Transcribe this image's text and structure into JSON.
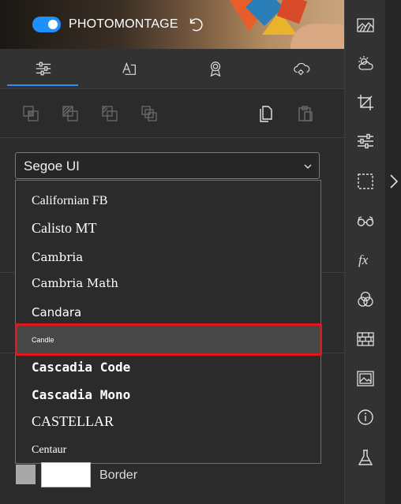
{
  "header": {
    "title": "PHOTOMONTAGE",
    "toggle_on": true
  },
  "tabs": [
    {
      "id": "adjust",
      "icon": "sliders-icon",
      "active": true
    },
    {
      "id": "text",
      "icon": "text-box-icon",
      "active": false
    },
    {
      "id": "badge",
      "icon": "award-icon",
      "active": false
    },
    {
      "id": "cloud",
      "icon": "cloud-settings-icon",
      "active": false
    }
  ],
  "toolbar": [
    "layer-back-icon",
    "layer-backward-icon",
    "layer-forward-icon",
    "layer-front-icon",
    "copy-icon",
    "paste-icon"
  ],
  "font_select": {
    "value": "Segoe UI"
  },
  "font_options": [
    {
      "label": "Californian FB",
      "family": "Liberation Serif",
      "size": "16px",
      "weight": "normal"
    },
    {
      "label": "Calisto MT",
      "family": "Liberation Serif",
      "size": "18px",
      "weight": "normal"
    },
    {
      "label": "Cambria",
      "family": "DejaVu Serif",
      "size": "15px",
      "weight": "normal"
    },
    {
      "label": "Cambria Math",
      "family": "DejaVu Serif",
      "size": "15px",
      "weight": "normal"
    },
    {
      "label": "Candara",
      "family": "DejaVu Sans",
      "size": "15px",
      "weight": "normal"
    },
    {
      "label": "Candle",
      "family": "Liberation Sans",
      "size": "9px",
      "weight": "normal",
      "selected": true
    },
    {
      "label": "Cascadia Code",
      "family": "DejaVu Sans Mono",
      "size": "16px",
      "weight": "bold"
    },
    {
      "label": "Cascadia Mono",
      "family": "DejaVu Sans Mono",
      "size": "16px",
      "weight": "bold"
    },
    {
      "label": "CASTELLAR",
      "family": "Liberation Serif",
      "size": "18px",
      "weight": "normal"
    },
    {
      "label": "Centaur",
      "family": "Liberation Serif",
      "size": "14px",
      "weight": "normal"
    }
  ],
  "border": {
    "label": "Border",
    "swatch_color": "#a8a8a8",
    "fill_color": "#ffffff"
  },
  "sidebar_icons": [
    "landscape-icon",
    "weather-icon",
    "crop-icon",
    "adjustments-icon",
    "selection-icon",
    "glasses-icon",
    "fx-icon",
    "color-circles-icon",
    "brick-wall-icon",
    "image-frame-icon",
    "info-icon",
    "flask-icon"
  ],
  "colors": {
    "accent": "#2d8cf0",
    "highlight": "#e0181d",
    "panel": "#2b2b2b"
  }
}
